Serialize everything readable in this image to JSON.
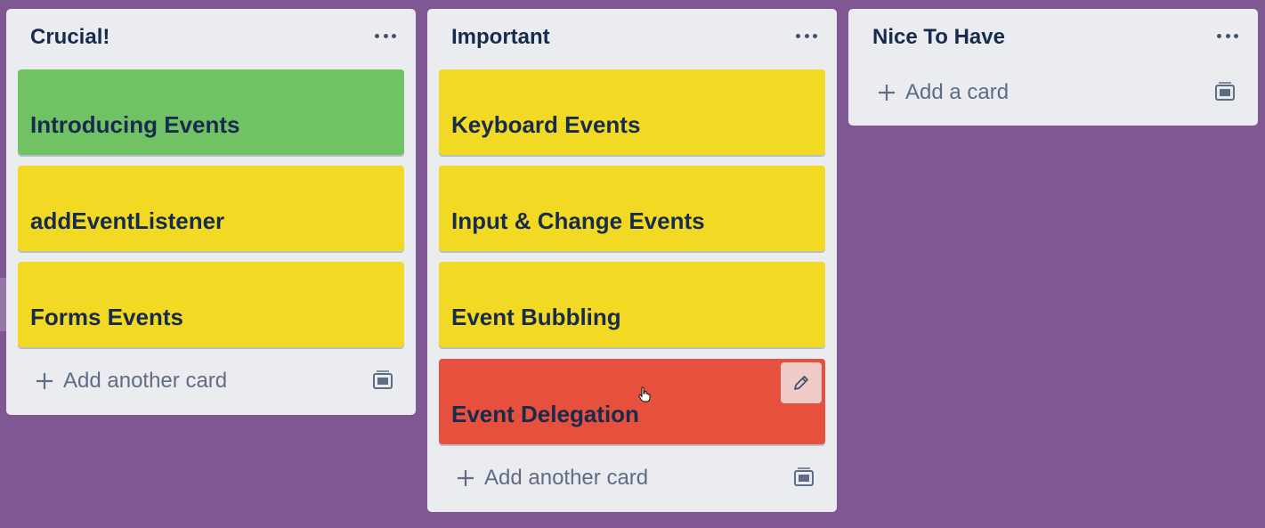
{
  "board": {
    "background": "#7f5893",
    "lists": [
      {
        "title": "Crucial!",
        "cards": [
          {
            "title": "Introducing Events",
            "color": "#70c264"
          },
          {
            "title": "addEventListener",
            "color": "#f2d924"
          },
          {
            "title": "Forms Events",
            "color": "#f2d924"
          }
        ],
        "add_label": "Add another card"
      },
      {
        "title": "Important",
        "cards": [
          {
            "title": "Keyboard Events",
            "color": "#f2d924"
          },
          {
            "title": "Input & Change Events",
            "color": "#f2d924"
          },
          {
            "title": "Event Bubbling",
            "color": "#f2d924"
          },
          {
            "title": "Event Delegation",
            "color": "#e6503c",
            "hovered": true
          }
        ],
        "add_label": "Add another card"
      },
      {
        "title": "Nice To Have",
        "cards": [],
        "add_label": "Add a card"
      }
    ]
  },
  "icons": {
    "list_menu": "ellipsis-icon",
    "add": "plus-icon",
    "template": "card-template-icon",
    "edit": "pencil-icon",
    "scroll": "chevron-left-icon"
  }
}
